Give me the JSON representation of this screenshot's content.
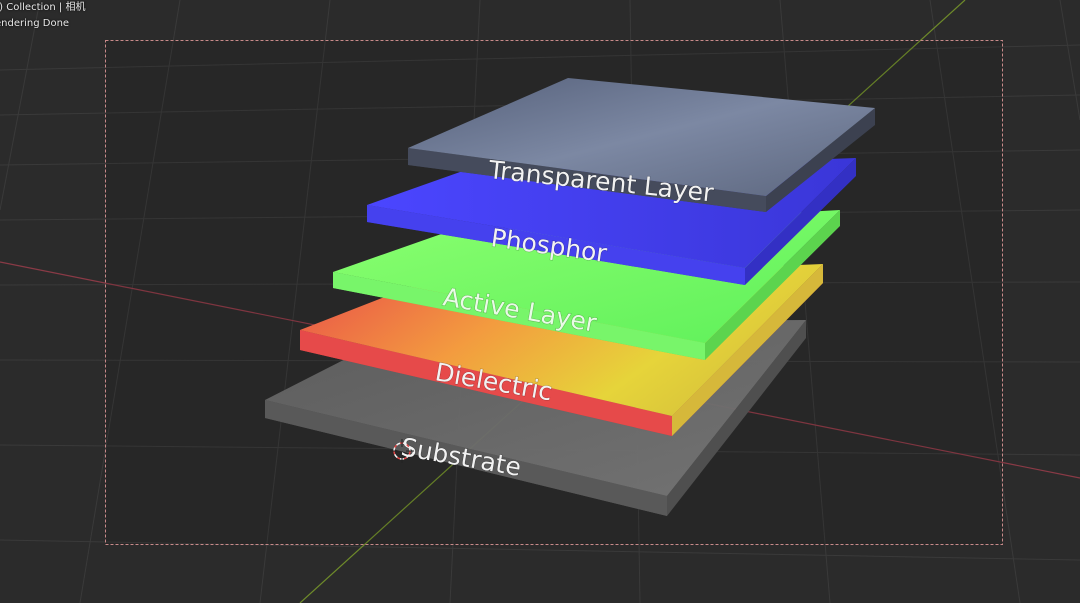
{
  "viewport_header": {
    "collection_text": ".) Collection | 相机",
    "render_status": "endering Done"
  },
  "scene": {
    "layers": [
      {
        "label": "Transparent Layer",
        "color": "#6b7690"
      },
      {
        "label": "Phosphor",
        "color": "#4a45f0"
      },
      {
        "label": "Active Layer",
        "color": "#7dff6a"
      },
      {
        "label": "Dielectric",
        "color": "#e84848"
      },
      {
        "label": "Substrate",
        "color": "#6a6a6a"
      }
    ],
    "colors": {
      "background": "#2b2b2b",
      "grid": "#3a3a3a",
      "x_axis": "#8a3a46",
      "y_axis": "#6e8a2a",
      "camera_frame": "#c98a8a"
    }
  }
}
